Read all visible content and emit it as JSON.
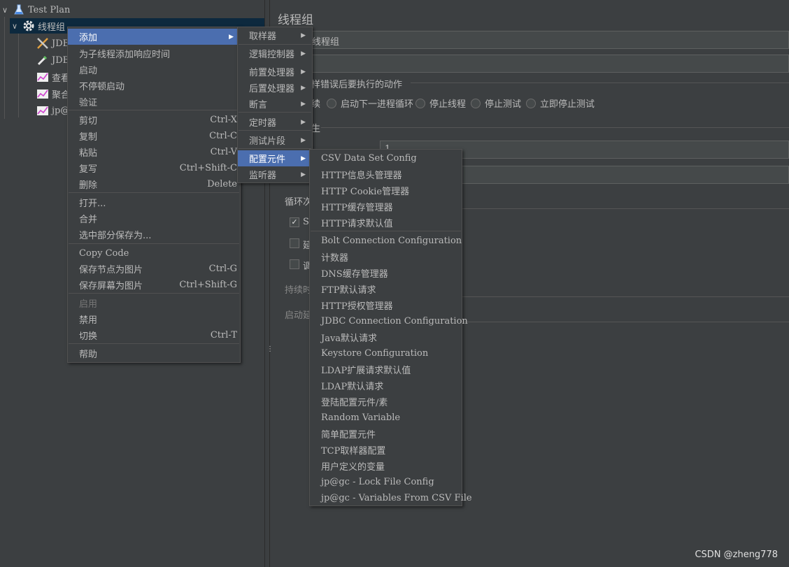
{
  "tree": {
    "items": [
      {
        "label": "Test Plan",
        "icon": "flask-icon"
      },
      {
        "label": "线程组",
        "icon": "gear-icon"
      },
      {
        "label": "JDB",
        "icon": "tools-icon"
      },
      {
        "label": "JDB",
        "icon": "pipette-icon"
      },
      {
        "label": "查看",
        "icon": "graph-icon"
      },
      {
        "label": "聚合",
        "icon": "graph-icon"
      },
      {
        "label": "jp@",
        "icon": "graph-icon"
      }
    ],
    "expand_glyph": "∨",
    "splitter_grip": "⋮"
  },
  "editor": {
    "title": "线程组",
    "name_value": "线程组",
    "error_action_label": "样错误后要执行的动作",
    "radio_continue": "续",
    "radio_next_loop": "启动下一进程循环",
    "radio_stop_thread": "停止线程",
    "radio_stop_test": "停止测试",
    "radio_stop_now": "立即停止测试",
    "thread_props_label": "生",
    "threads_value": "1",
    "loop_label": "循环次",
    "check_same_user": "Sa",
    "check_delay": "延",
    "check_scheduler": "调",
    "duration_label": "持续时",
    "startup_delay_label": "启动延",
    "check_mark": "✓"
  },
  "context_menu": {
    "items": [
      {
        "label": "添加",
        "shortcut": "",
        "submenu": true,
        "active": true
      },
      {
        "label": "为子线程添加响应时间",
        "shortcut": ""
      },
      {
        "label": "启动",
        "shortcut": ""
      },
      {
        "label": "不停顿启动",
        "shortcut": ""
      },
      {
        "label": "验证",
        "shortcut": ""
      },
      {
        "label": "剪切",
        "shortcut": "Ctrl-X"
      },
      {
        "label": "复制",
        "shortcut": "Ctrl-C"
      },
      {
        "label": "粘贴",
        "shortcut": "Ctrl-V"
      },
      {
        "label": "复写",
        "shortcut": "Ctrl+Shift-C"
      },
      {
        "label": "删除",
        "shortcut": "Delete"
      },
      {
        "label": "打开...",
        "shortcut": ""
      },
      {
        "label": "合并",
        "shortcut": ""
      },
      {
        "label": "选中部分保存为...",
        "shortcut": ""
      },
      {
        "label": "Copy Code",
        "shortcut": ""
      },
      {
        "label": "保存节点为图片",
        "shortcut": "Ctrl-G"
      },
      {
        "label": "保存屏幕为图片",
        "shortcut": "Ctrl+Shift-G"
      },
      {
        "label": "启用",
        "shortcut": "",
        "disabled": true
      },
      {
        "label": "禁用",
        "shortcut": ""
      },
      {
        "label": "切换",
        "shortcut": "Ctrl-T"
      },
      {
        "label": "帮助",
        "shortcut": ""
      }
    ]
  },
  "add_submenu": {
    "items": [
      {
        "label": "取样器"
      },
      {
        "label": "逻辑控制器"
      },
      {
        "label": "前置处理器"
      },
      {
        "label": "后置处理器"
      },
      {
        "label": "断言"
      },
      {
        "label": "定时器"
      },
      {
        "label": "测试片段"
      },
      {
        "label": "配置元件",
        "active": true
      },
      {
        "label": "监听器"
      }
    ],
    "arrow_glyph": "▶"
  },
  "config_submenu": {
    "items": [
      {
        "label": "CSV Data Set Config"
      },
      {
        "label": "HTTP信息头管理器"
      },
      {
        "label": "HTTP Cookie管理器"
      },
      {
        "label": "HTTP缓存管理器"
      },
      {
        "label": "HTTP请求默认值"
      },
      {
        "label": "Bolt Connection Configuration"
      },
      {
        "label": "计数器"
      },
      {
        "label": "DNS缓存管理器"
      },
      {
        "label": "FTP默认请求"
      },
      {
        "label": "HTTP授权管理器"
      },
      {
        "label": "JDBC Connection Configuration"
      },
      {
        "label": "Java默认请求"
      },
      {
        "label": "Keystore Configuration"
      },
      {
        "label": "LDAP扩展请求默认值"
      },
      {
        "label": "LDAP默认请求"
      },
      {
        "label": "登陆配置元件/素"
      },
      {
        "label": "Random Variable"
      },
      {
        "label": "简单配置元件"
      },
      {
        "label": "TCP取样器配置"
      },
      {
        "label": "用户定义的变量"
      },
      {
        "label": "jp@gc - Lock File Config"
      },
      {
        "label": "jp@gc - Variables From CSV File"
      }
    ]
  },
  "watermark": "CSDN @zheng778",
  "colors": {
    "background": "#3c3f41",
    "selection": "#4b6eaf",
    "tree_selection": "#0d293e"
  }
}
